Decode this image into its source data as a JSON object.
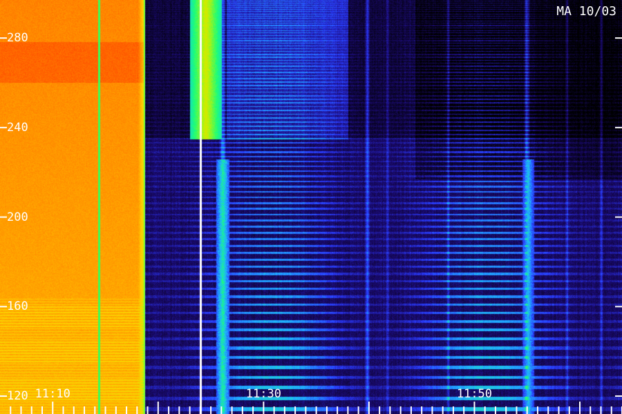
{
  "title": "MA 10/03",
  "chart_data": {
    "type": "heatmap",
    "title": "MA 10/03",
    "xlabel": "",
    "ylabel": "",
    "x_ticks": [
      "11:10",
      "11:30",
      "11:50"
    ],
    "x_tick_minutes": [
      670,
      690,
      710
    ],
    "xlim_minutes": [
      665,
      724
    ],
    "y_ticks": [
      120,
      160,
      200,
      240,
      280
    ],
    "ylim": [
      112,
      297
    ],
    "colormap": [
      "#000000",
      "#1a0a6e",
      "#2a3cff",
      "#1fb7ff",
      "#19ff7a",
      "#c8f000",
      "#ffd000",
      "#ff8a00",
      "#ff3a00"
    ],
    "series": [
      {
        "name": "",
        "type": "background-intensity",
        "x_range_minutes": [
          665,
          678.6
        ],
        "level": "high"
      },
      {
        "name": "",
        "type": "bright-vertical",
        "x_minutes": 674.4
      },
      {
        "name": "",
        "type": "bright-vertical",
        "x_minutes": 684.0
      },
      {
        "name": "",
        "type": "emission-patch",
        "x_range_minutes": [
          683.0,
          686.0
        ],
        "y_range": [
          235,
          297
        ]
      },
      {
        "name": "",
        "type": "emission-patch",
        "x_range_minutes": [
          686.5,
          698.0
        ],
        "y_range": [
          235,
          297
        ]
      }
    ]
  }
}
